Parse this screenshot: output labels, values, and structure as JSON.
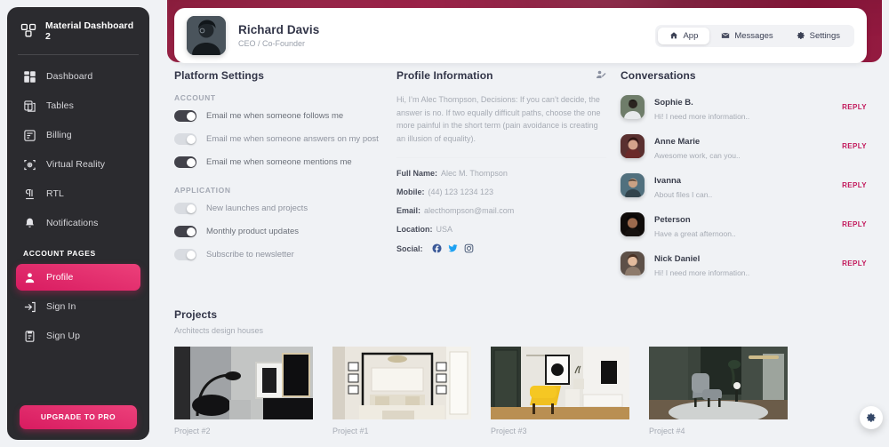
{
  "sidebar": {
    "brand": "Material Dashboard 2",
    "brand_icon": "dashboard-logo-icon",
    "items": [
      {
        "label": "Dashboard",
        "icon": "dashboard-icon",
        "active": false
      },
      {
        "label": "Tables",
        "icon": "tables-icon",
        "active": false
      },
      {
        "label": "Billing",
        "icon": "billing-icon",
        "active": false
      },
      {
        "label": "Virtual Reality",
        "icon": "vr-headset-icon",
        "active": false
      },
      {
        "label": "RTL",
        "icon": "rtl-icon",
        "active": false
      },
      {
        "label": "Notifications",
        "icon": "bell-icon",
        "active": false
      }
    ],
    "section_label": "ACCOUNT PAGES",
    "account_items": [
      {
        "label": "Profile",
        "icon": "person-icon",
        "active": true
      },
      {
        "label": "Sign In",
        "icon": "sign-in-icon",
        "active": false
      },
      {
        "label": "Sign Up",
        "icon": "sign-up-icon",
        "active": false
      }
    ],
    "upgrade_label": "UPGRADE TO PRO",
    "accent_color": "#d81b60",
    "background_color": "#2b2b2f"
  },
  "header": {
    "name": "Richard Davis",
    "role": "CEO / Co-Founder",
    "avatar": "user-avatar",
    "tabs": [
      {
        "label": "App",
        "icon": "home-icon",
        "active": true
      },
      {
        "label": "Messages",
        "icon": "envelope-icon",
        "active": false
      },
      {
        "label": "Settings",
        "icon": "gear-icon",
        "active": false
      }
    ]
  },
  "platform_settings": {
    "title": "Platform Settings",
    "account_label": "ACCOUNT",
    "account_toggles": [
      {
        "label": "Email me when someone follows me",
        "on": true
      },
      {
        "label": "Email me when someone answers on my post",
        "on": false
      },
      {
        "label": "Email me when someone mentions me",
        "on": true
      }
    ],
    "application_label": "APPLICATION",
    "application_toggles": [
      {
        "label": "New launches and projects",
        "on": false
      },
      {
        "label": "Monthly product updates",
        "on": true
      },
      {
        "label": "Subscribe to newsletter",
        "on": false
      }
    ]
  },
  "profile_information": {
    "title": "Profile Information",
    "edit_icon": "edit-profile-icon",
    "description": "Hi, I’m Alec Thompson, Decisions: If you can’t decide, the answer is no. If two equally difficult paths, choose the one more painful in the short term (pain avoidance is creating an illusion of equality).",
    "fields": [
      {
        "label": "Full Name:",
        "value": "Alec M. Thompson"
      },
      {
        "label": "Mobile:",
        "value": "(44) 123 1234 123"
      },
      {
        "label": "Email:",
        "value": "alecthompson@mail.com"
      },
      {
        "label": "Location:",
        "value": "USA"
      }
    ],
    "social_label": "Social:",
    "social": [
      {
        "icon": "facebook-icon",
        "color": "#3b5998"
      },
      {
        "icon": "twitter-icon",
        "color": "#1da1f2"
      },
      {
        "icon": "instagram-icon",
        "color": "#344767"
      }
    ]
  },
  "conversations": {
    "title": "Conversations",
    "reply_label": "REPLY",
    "items": [
      {
        "name": "Sophie B.",
        "message": "Hi! I need more information.."
      },
      {
        "name": "Anne Marie",
        "message": "Awesome work, can you.."
      },
      {
        "name": "Ivanna",
        "message": "About files I can.."
      },
      {
        "name": "Peterson",
        "message": "Have a great afternoon.."
      },
      {
        "name": "Nick Daniel",
        "message": "Hi! I need more information.."
      }
    ]
  },
  "projects": {
    "title": "Projects",
    "subtitle": "Architects design houses",
    "items": [
      {
        "name": "Project #2"
      },
      {
        "name": "Project #1"
      },
      {
        "name": "Project #3"
      },
      {
        "name": "Project #4"
      }
    ]
  },
  "fab": {
    "icon": "gear-icon"
  }
}
